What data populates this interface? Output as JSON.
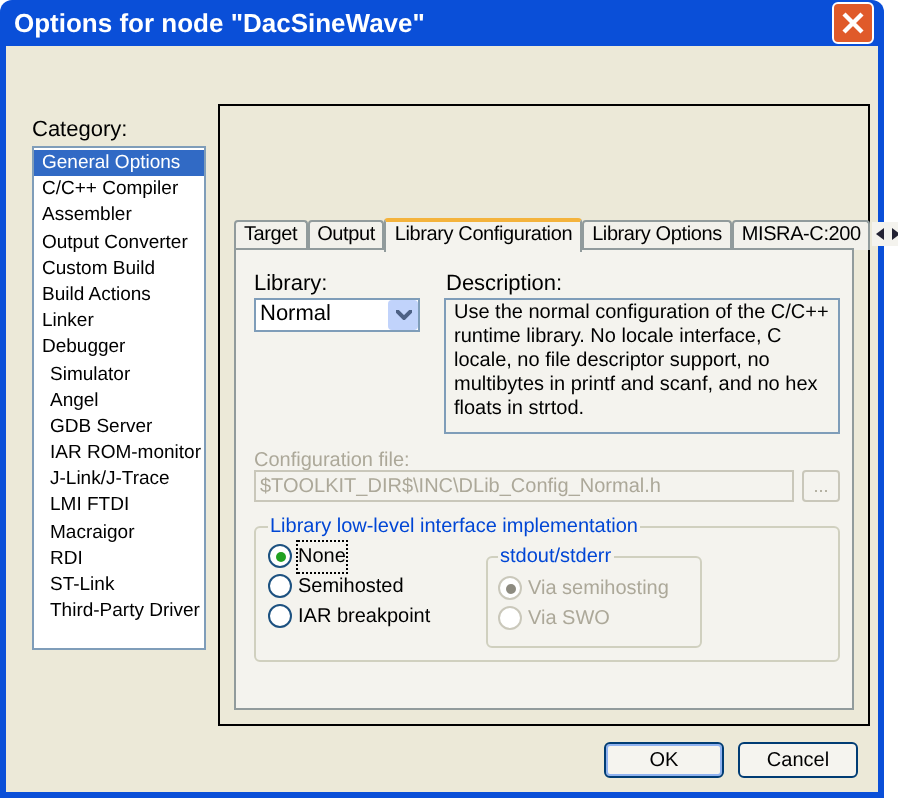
{
  "window": {
    "title": "Options for node \"DacSineWave\""
  },
  "category": {
    "label": "Category:",
    "items": [
      {
        "label": "General Options",
        "selected": true
      },
      {
        "label": "C/C++ Compiler",
        "selected": false
      },
      {
        "label": "Assembler",
        "selected": false
      },
      {
        "label": "Output Converter",
        "selected": false
      },
      {
        "label": "Custom Build",
        "selected": false
      },
      {
        "label": "Build Actions",
        "selected": false
      },
      {
        "label": "Linker",
        "selected": false
      },
      {
        "label": "Debugger",
        "selected": false,
        "children": [
          {
            "label": "Simulator",
            "selected": false
          },
          {
            "label": "Angel",
            "selected": false
          },
          {
            "label": "GDB Server",
            "selected": false
          },
          {
            "label": "IAR ROM-monitor",
            "selected": false
          },
          {
            "label": "J-Link/J-Trace",
            "selected": false
          },
          {
            "label": "LMI FTDI",
            "selected": false
          },
          {
            "label": "Macraigor",
            "selected": false
          },
          {
            "label": "RDI",
            "selected": false
          },
          {
            "label": "ST-Link",
            "selected": false
          },
          {
            "label": "Third-Party Driver",
            "selected": false
          }
        ]
      }
    ]
  },
  "tabs": [
    {
      "label": "Target",
      "selected": false
    },
    {
      "label": "Output",
      "selected": false
    },
    {
      "label": "Library Configuration",
      "selected": true
    },
    {
      "label": "Library Options",
      "selected": false
    },
    {
      "label": "MISRA-C:200",
      "selected": false
    }
  ],
  "library": {
    "label": "Library:",
    "value": "Normal"
  },
  "description": {
    "label": "Description:",
    "text": "Use the normal configuration of the C/C++ runtime library. No locale interface, C locale, no file descriptor support, no multibytes in printf and scanf, and no hex floats in strtod."
  },
  "configuration_file": {
    "label": "Configuration file:",
    "value": "$TOOLKIT_DIR$\\INC\\DLib_Config_Normal.h",
    "browse": "...",
    "disabled": true
  },
  "interface": {
    "title": "Library low-level interface implementation",
    "options": [
      {
        "label": "None",
        "selected": true
      },
      {
        "label": "Semihosted",
        "selected": false
      },
      {
        "label": "IAR breakpoint",
        "selected": false
      }
    ]
  },
  "stdout": {
    "title": "stdout/stderr",
    "disabled": true,
    "options": [
      {
        "label": "Via semihosting",
        "selected": true
      },
      {
        "label": "Via SWO",
        "selected": false
      }
    ]
  },
  "buttons": [
    "OK",
    "Cancel"
  ]
}
